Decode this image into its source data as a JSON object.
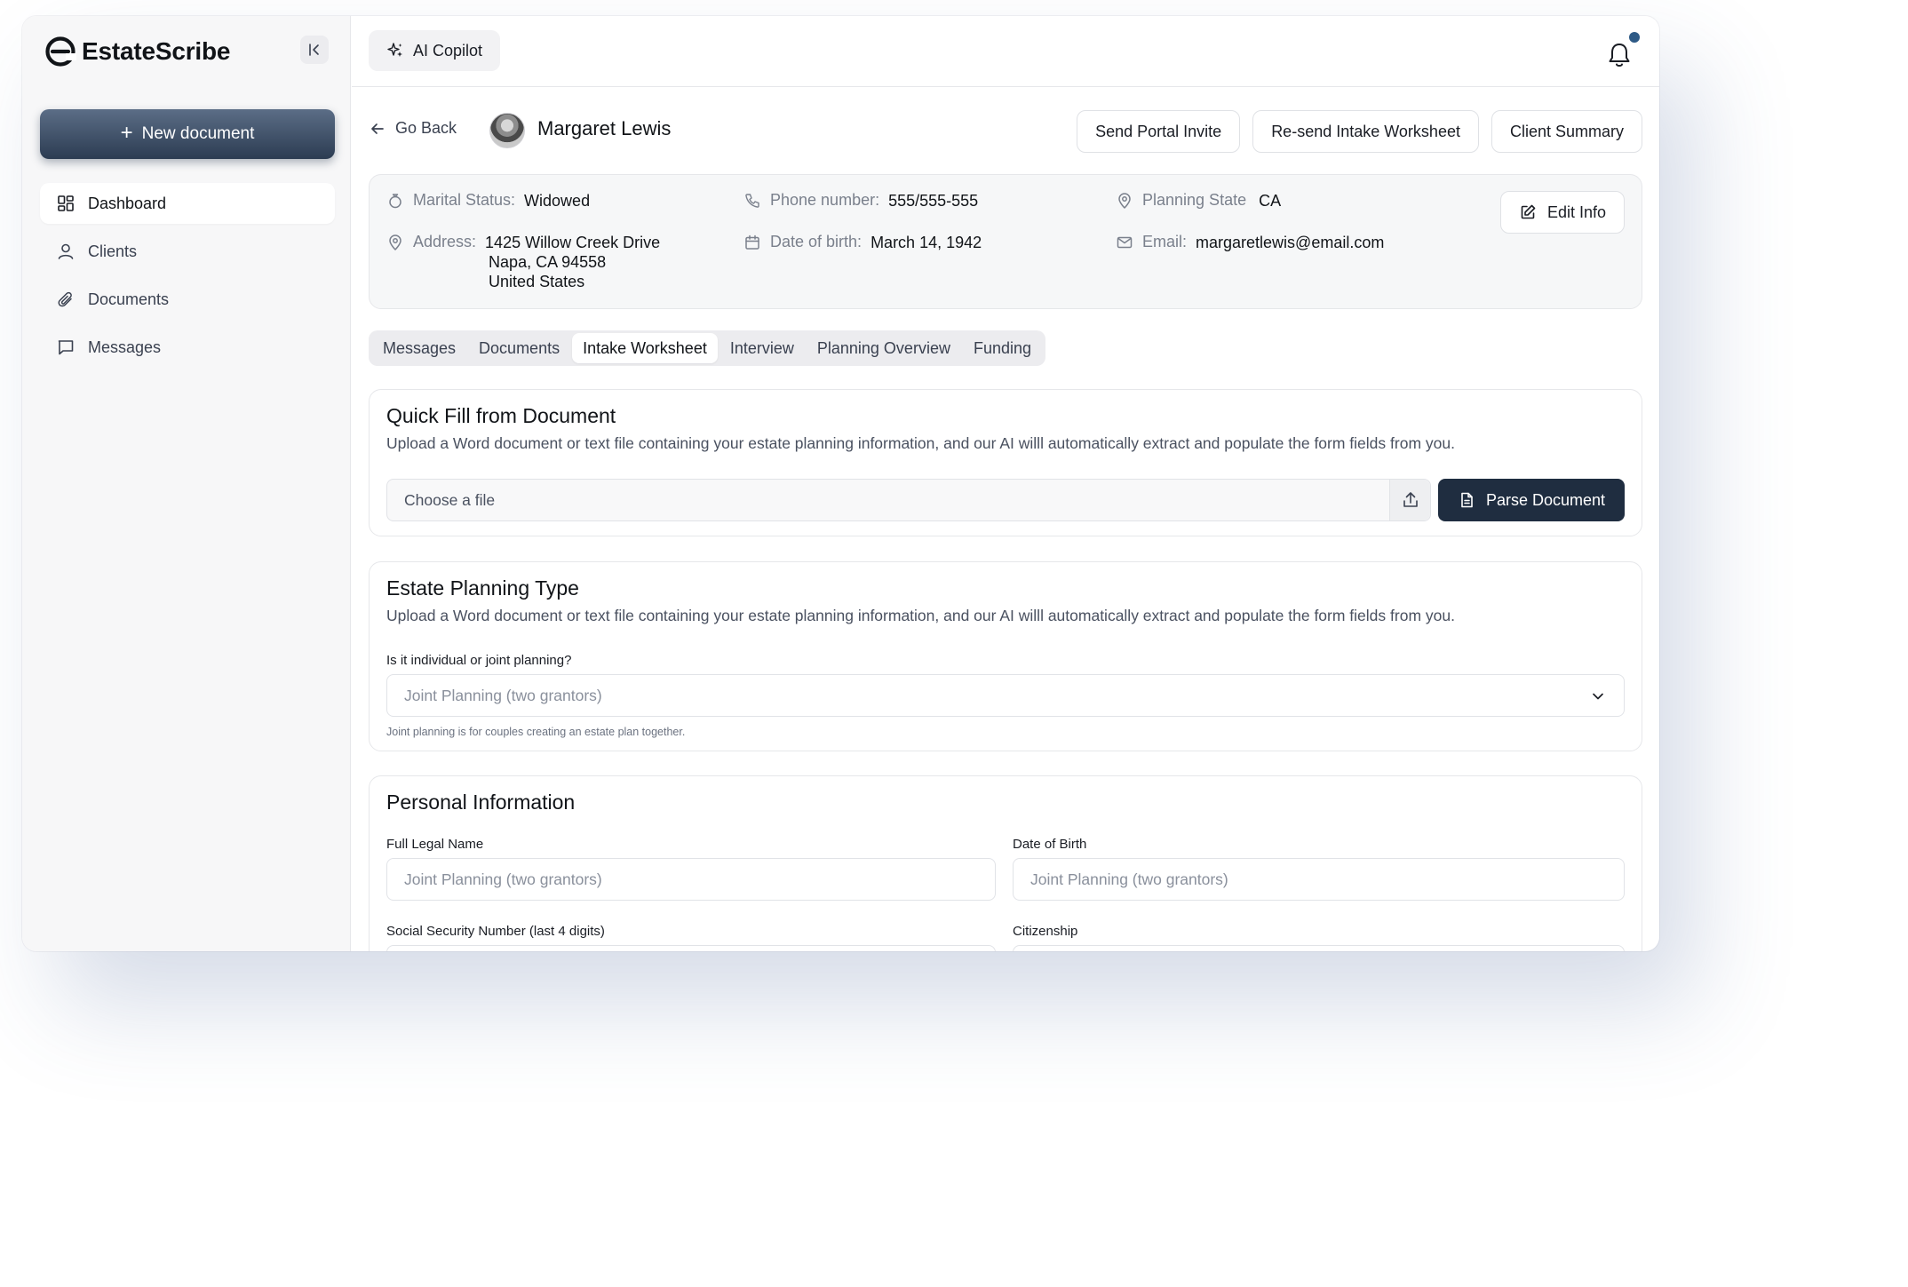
{
  "brand": {
    "name": "EstateScribe"
  },
  "sidebar": {
    "new_document_label": "New document",
    "items": [
      {
        "label": "Dashboard",
        "icon": "dashboard-icon",
        "active": true
      },
      {
        "label": "Clients",
        "icon": "user-icon",
        "active": false
      },
      {
        "label": "Documents",
        "icon": "paperclip-icon",
        "active": false
      },
      {
        "label": "Messages",
        "icon": "message-icon",
        "active": false
      }
    ]
  },
  "topbar": {
    "copilot_label": "AI Copilot",
    "notification_dot_color": "#2e5a86"
  },
  "header": {
    "go_back_label": "Go Back",
    "client_name": "Margaret Lewis",
    "buttons": {
      "send_portal": "Send Portal Invite",
      "resend_intake": "Re-send Intake Worksheet",
      "client_summary": "Client Summary"
    }
  },
  "client_info": {
    "marital_status_label": "Marital Status:",
    "marital_status": "Widowed",
    "phone_label": "Phone number:",
    "phone": "555/555-555",
    "planning_state_label": "Planning State",
    "planning_state": "CA",
    "address_label": "Address:",
    "address_line1": "1425 Willow Creek Drive",
    "address_line2": "Napa, CA 94558",
    "address_line3": "United States",
    "dob_label": "Date of birth:",
    "dob": "March 14, 1942",
    "email_label": "Email:",
    "email": "margaretlewis@email.com",
    "edit_label": "Edit Info"
  },
  "tabs": [
    {
      "label": "Messages",
      "active": false
    },
    {
      "label": "Documents",
      "active": false
    },
    {
      "label": "Intake Worksheet",
      "active": true
    },
    {
      "label": "Interview",
      "active": false
    },
    {
      "label": "Planning Overview",
      "active": false
    },
    {
      "label": "Funding",
      "active": false
    }
  ],
  "quick_fill": {
    "title": "Quick Fill from Document",
    "description": "Upload a Word document or text file containing your estate planning information, and our AI willl automatically extract and populate the form fields from you.",
    "file_placeholder": "Choose a file",
    "parse_label": "Parse Document"
  },
  "estate_type": {
    "title": "Estate Planning Type",
    "description": "Upload a Word document or text file containing your estate planning information, and our AI willl automatically extract and populate the form fields from you.",
    "question": "Is it individual or joint planning?",
    "selected": "Joint Planning (two grantors)",
    "hint": "Joint planning is for couples creating an estate plan together."
  },
  "personal_info": {
    "title": "Personal Information",
    "full_name_label": "Full Legal Name",
    "full_name_placeholder": "Joint Planning (two grantors)",
    "dob_label": "Date of Birth",
    "dob_placeholder": "Joint Planning (two grantors)",
    "ssn_label": "Social Security Number (last 4 digits)",
    "citizenship_label": "Citizenship"
  },
  "colors": {
    "primary_dark": "#1f2d40",
    "sidebar_bg": "#f7f7f8",
    "accent_dot": "#2e5a86"
  }
}
